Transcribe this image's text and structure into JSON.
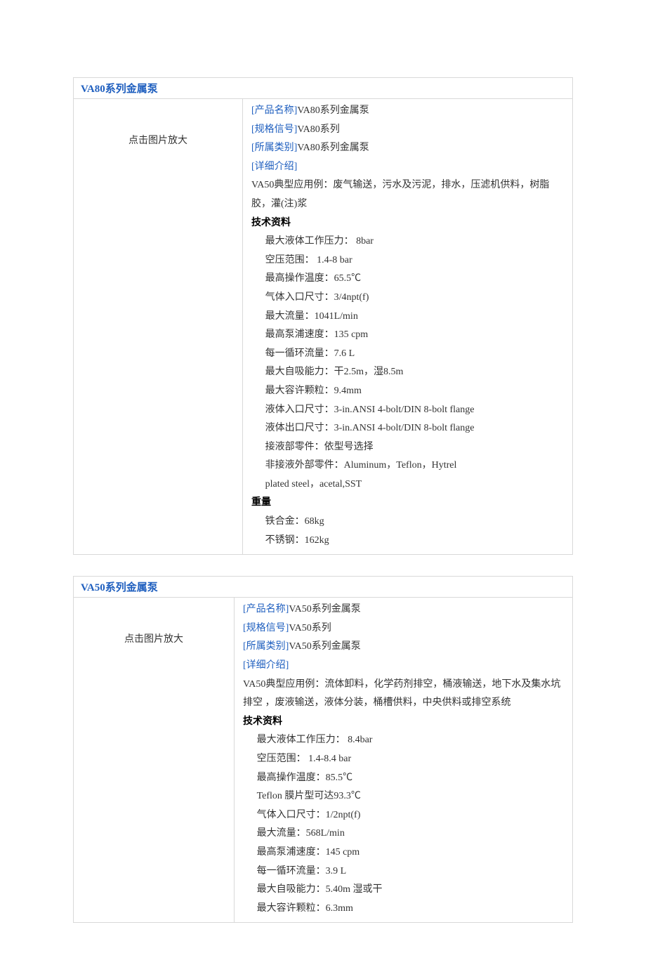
{
  "products": [
    {
      "title": "VA80系列金属泵",
      "image_hint": "点击图片放大",
      "labels": {
        "name": "[产品名称]",
        "spec": "[规格信号]",
        "category": "[所属类别]",
        "detail": "[详细介绍]"
      },
      "name": "VA80系列金属泵",
      "spec": "VA80系列",
      "category": "VA80系列金属泵",
      "intro": "VA50典型应用例：废气输送，污水及污泥，排水，压滤机供料，树脂胶，灌(注)浆",
      "tech_heading": "技术资料",
      "tech": [
        "最大液体工作压力： 8bar",
        "空压范围： 1.4-8 bar",
        "最高操作温度：65.5℃",
        "气体入口尺寸：3/4npt(f)",
        "最大流量：1041L/min",
        "最高泵浦速度：135 cpm",
        "每一循环流量：7.6 L",
        "最大自吸能力：干2.5m，湿8.5m",
        "最大容许颗粒：9.4mm",
        "液体入口尺寸：3-in.ANSI 4-bolt/DIN 8-bolt flange",
        "液体出口尺寸：3-in.ANSI 4-bolt/DIN 8-bolt flange",
        "接液部零件：依型号选择",
        "非接液外部零件：Aluminum，Teflon，Hytrel",
        "plated steel，acetal,SST"
      ],
      "weight_heading": "重量",
      "weight": [
        "铁合金：68kg",
        "不锈钢：162kg"
      ]
    },
    {
      "title": "VA50系列金属泵",
      "image_hint": "点击图片放大",
      "labels": {
        "name": "[产品名称]",
        "spec": "[规格信号]",
        "category": "[所属类别]",
        "detail": "[详细介绍]"
      },
      "name": "VA50系列金属泵",
      "spec": "VA50系列",
      "category": "VA50系列金属泵",
      "intro": "VA50典型应用例：流体卸料，化学药剂排空，桶液输送，地下水及集水坑排空 ，废液输送，液体分装，桶槽供料，中央供料或排空系统",
      "tech_heading": "技术资料",
      "tech": [
        "最大液体工作压力： 8.4bar",
        "空压范围： 1.4-8.4 bar",
        "最高操作温度：85.5℃",
        "Teflon 膜片型可达93.3℃",
        "气体入口尺寸：1/2npt(f)",
        "最大流量：568L/min",
        "最高泵浦速度：145 cpm",
        "每一循环流量：3.9 L",
        "最大自吸能力：5.40m 湿或干",
        "最大容许颗粒：6.3mm"
      ],
      "weight_heading": "",
      "weight": []
    }
  ]
}
